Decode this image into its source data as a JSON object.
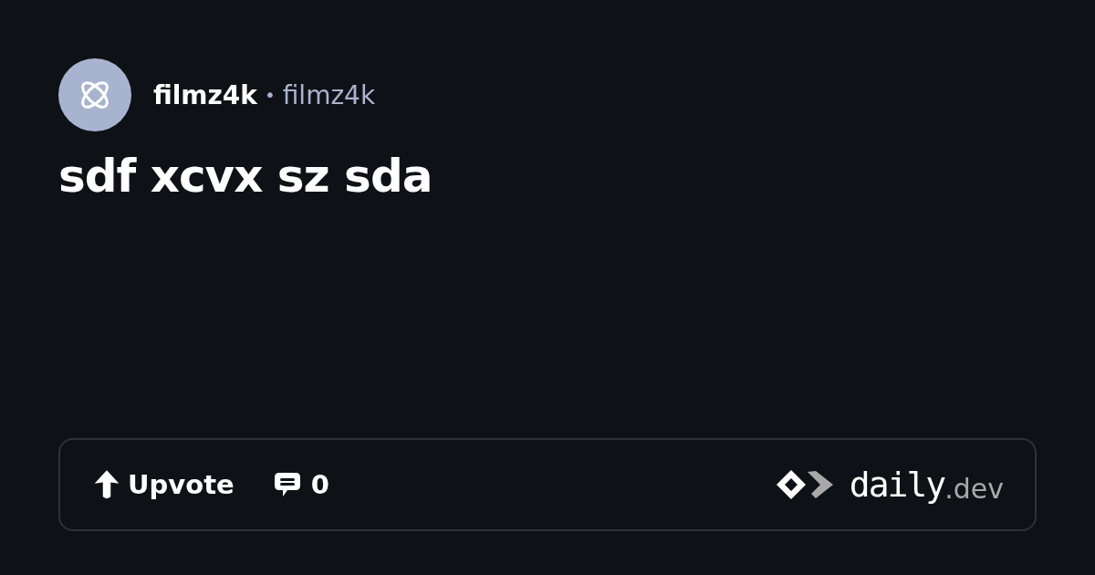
{
  "author": {
    "name": "filmz4k",
    "separator": "•",
    "handle": "filmz4k"
  },
  "title": "sdf xcvx sz sda",
  "actions": {
    "upvote": "Upvote",
    "comments": "0"
  },
  "brand": {
    "name": "daily",
    "suffix": ".dev"
  }
}
